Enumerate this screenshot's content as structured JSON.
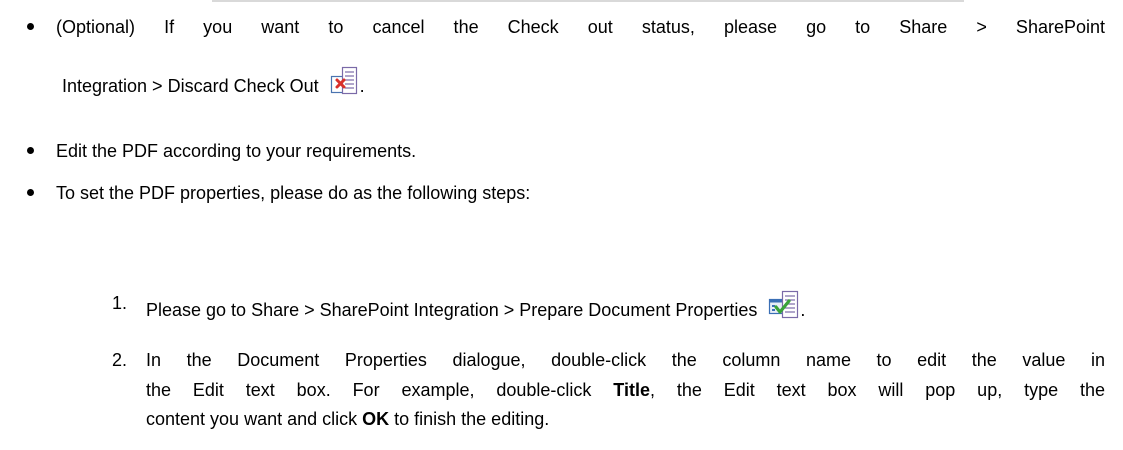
{
  "bullets": [
    {
      "line1": "(Optional) If you want to cancel the Check out status, please go to Share > SharePoint",
      "line2": "Integration > Discard Check Out",
      "icon": "discard-check-out-icon",
      "trail": "."
    },
    {
      "text": "Edit the PDF according to your requirements."
    },
    {
      "text": "To set the PDF properties, please do as the following steps:"
    }
  ],
  "steps": [
    {
      "number": "1.",
      "text": "Please go to Share > SharePoint Integration > Prepare Document Properties",
      "icon": "prepare-document-properties-icon",
      "trail": "."
    },
    {
      "number": "2.",
      "line1": "In the Document Properties dialogue, double-click the column name to edit the value in",
      "line2_a": "the Edit text box. For example, double-click ",
      "line2_bold": "Title",
      "line2_b": ", the Edit text box will pop up, type the",
      "line3_a": "content you want and click ",
      "line3_bold": "OK",
      "line3_b": " to finish the editing."
    }
  ],
  "colors": {
    "text": "#000000",
    "rule": "#d9d9d9",
    "icon_red": "#d9302c",
    "icon_green": "#3aa33a",
    "icon_blue": "#3a6fb5"
  }
}
